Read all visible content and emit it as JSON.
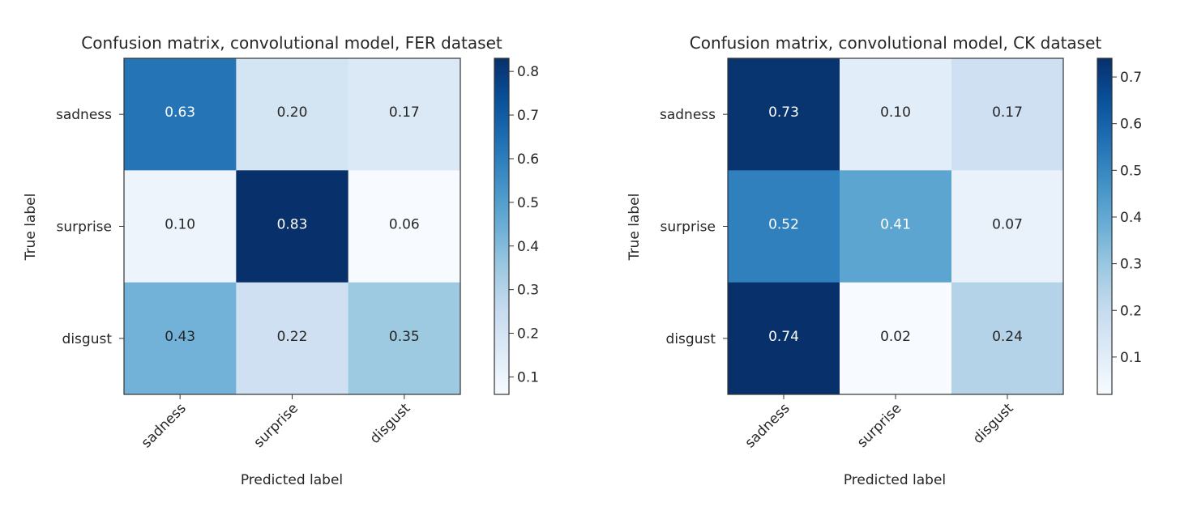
{
  "chart_data": [
    {
      "type": "heatmap",
      "title": "Confusion matrix, convolutional model, FER dataset",
      "xlabel": "Predicted label",
      "ylabel": "True label",
      "x_categories": [
        "sadness",
        "surprise",
        "disgust"
      ],
      "y_categories": [
        "sadness",
        "surprise",
        "disgust"
      ],
      "values": [
        [
          0.63,
          0.2,
          0.17
        ],
        [
          0.1,
          0.83,
          0.06
        ],
        [
          0.43,
          0.22,
          0.35
        ]
      ],
      "value_labels": [
        [
          "0.63",
          "0.20",
          "0.17"
        ],
        [
          "0.10",
          "0.83",
          "0.06"
        ],
        [
          "0.43",
          "0.22",
          "0.35"
        ]
      ],
      "colormap": "Blues",
      "colorbar": {
        "range": [
          0.06,
          0.83
        ],
        "ticks": [
          0.1,
          0.2,
          0.3,
          0.4,
          0.5,
          0.6,
          0.7,
          0.8
        ],
        "tick_labels": [
          "0.1",
          "0.2",
          "0.3",
          "0.4",
          "0.5",
          "0.6",
          "0.7",
          "0.8"
        ]
      },
      "grid": false
    },
    {
      "type": "heatmap",
      "title": "Confusion matrix, convolutional model, CK dataset",
      "xlabel": "Predicted label",
      "ylabel": "True label",
      "x_categories": [
        "sadness",
        "surprise",
        "disgust"
      ],
      "y_categories": [
        "sadness",
        "surprise",
        "disgust"
      ],
      "values": [
        [
          0.73,
          0.1,
          0.17
        ],
        [
          0.52,
          0.41,
          0.07
        ],
        [
          0.74,
          0.02,
          0.24
        ]
      ],
      "value_labels": [
        [
          "0.73",
          "0.10",
          "0.17"
        ],
        [
          "0.52",
          "0.41",
          "0.07"
        ],
        [
          "0.74",
          "0.02",
          "0.24"
        ]
      ],
      "colormap": "Blues",
      "colorbar": {
        "range": [
          0.02,
          0.74
        ],
        "ticks": [
          0.1,
          0.2,
          0.3,
          0.4,
          0.5,
          0.6,
          0.7
        ],
        "tick_labels": [
          "0.1",
          "0.2",
          "0.3",
          "0.4",
          "0.5",
          "0.6",
          "0.7"
        ]
      },
      "grid": false
    }
  ],
  "colors": {
    "text_dark": "#262626",
    "text_light": "#ffffff",
    "frame": "#333333"
  }
}
